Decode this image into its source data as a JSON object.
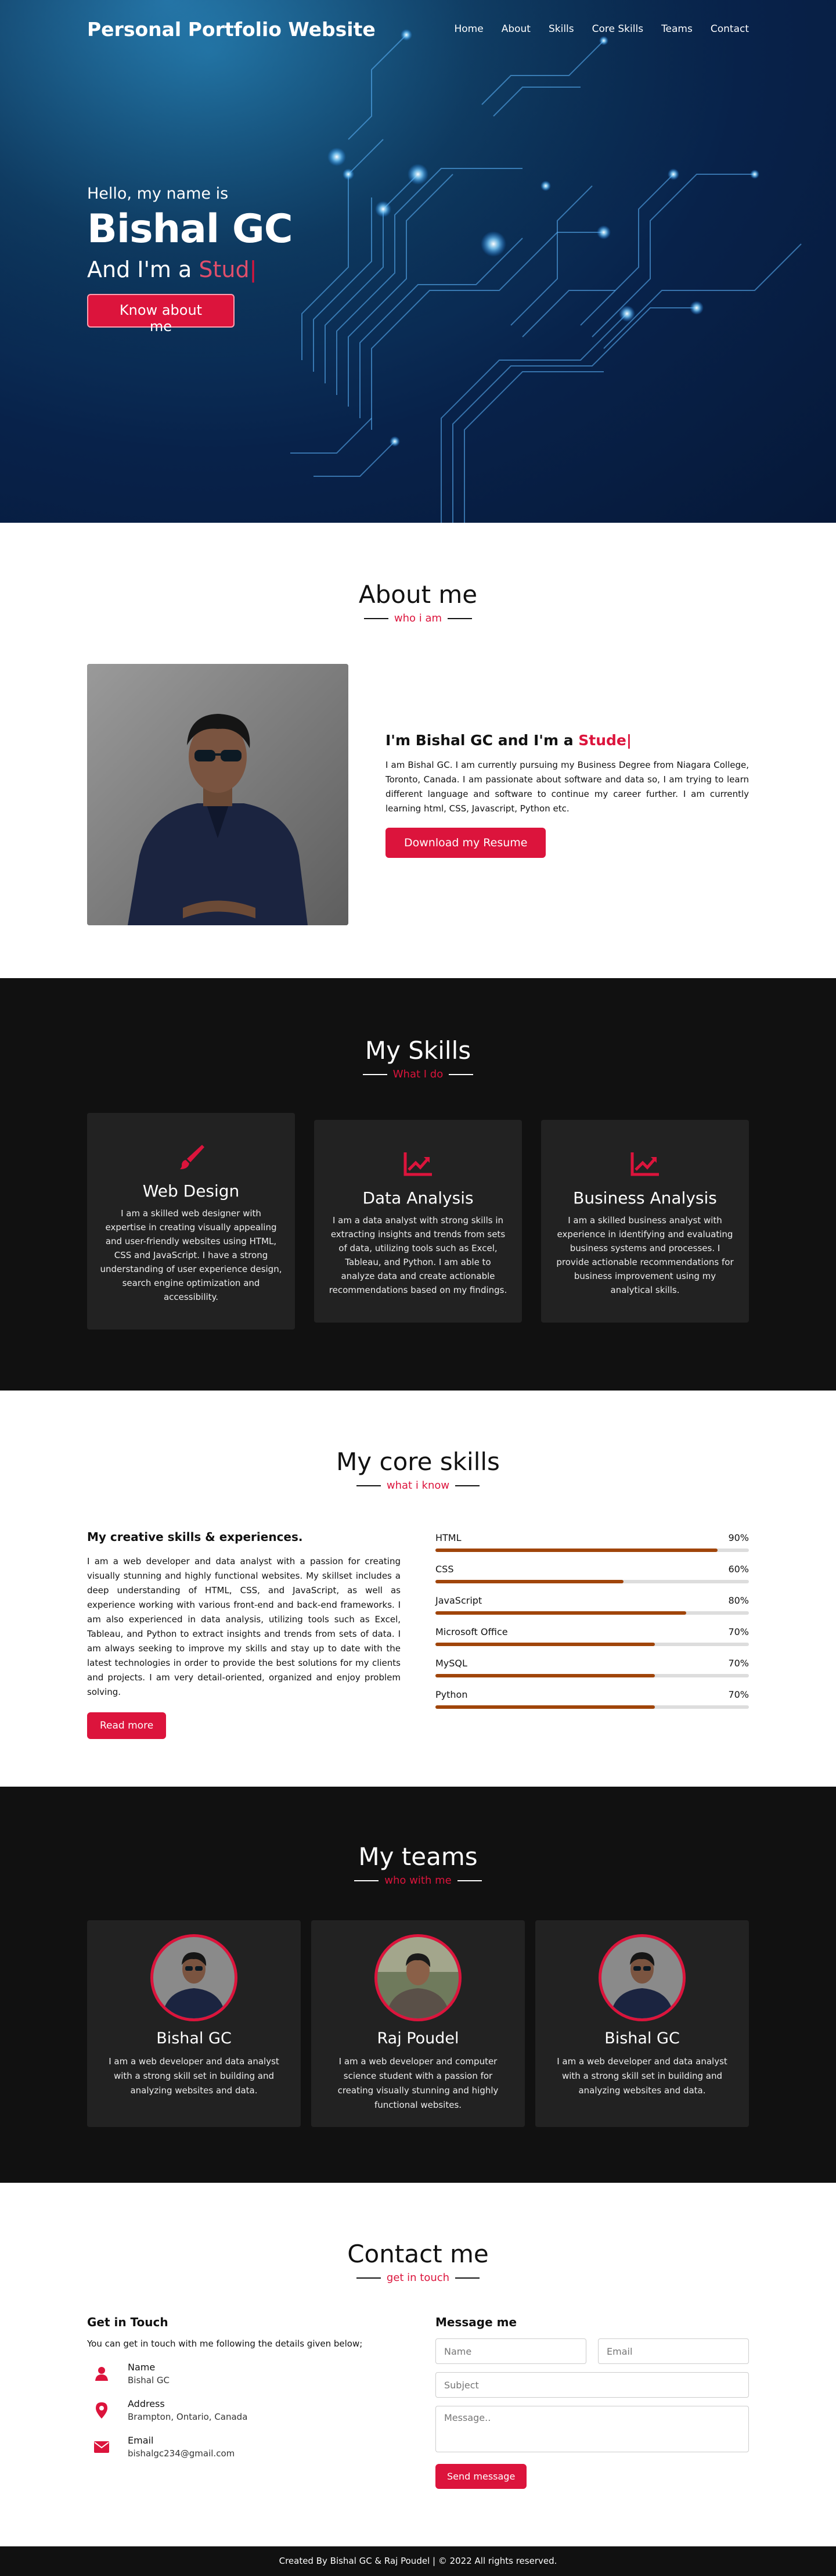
{
  "navbar": {
    "logo": "Personal Portfolio Website",
    "menu": [
      "Home",
      "About",
      "Skills",
      "Core Skills",
      "Teams",
      "Contact"
    ]
  },
  "hero": {
    "hello": "Hello, my name is",
    "name": "Bishal GC",
    "role_prefix": "And I'm a ",
    "role_typed": "Stud",
    "caret": "|",
    "button": "Know about me"
  },
  "about": {
    "title": "About me",
    "subtitle": "who i am",
    "heading_prefix": "I'm Bishal GC and I'm a ",
    "heading_typed": "Stude",
    "caret": "|",
    "paragraph": "I am Bishal GC. I am currently pursuing my Business Degree from Niagara College, Toronto, Canada. I am passionate about software and data so, I am trying to learn different language and software to continue my career further. I am currently learning html, CSS, Javascript, Python etc.",
    "button": "Download my Resume"
  },
  "services": {
    "title": "My Skills",
    "subtitle": "What I do",
    "cards": [
      {
        "icon": "paint-brush-icon",
        "title": "Web Design",
        "text": "I am a skilled web designer with expertise in creating visually appealing and user-friendly websites using HTML, CSS and JavaScript. I have a strong understanding of user experience design, search engine optimization and accessibility."
      },
      {
        "icon": "chart-line-icon",
        "title": "Data Analysis",
        "text": "I am a data analyst with strong skills in extracting insights and trends from sets of data, utilizing tools such as Excel, Tableau, and Python. I am able to analyze data and create actionable recommendations based on my findings."
      },
      {
        "icon": "chart-line-icon",
        "title": "Business Analysis",
        "text": "I am a skilled business analyst with experience in identifying and evaluating business systems and processes. I provide actionable recommendations for business improvement using my analytical skills."
      }
    ]
  },
  "skills": {
    "title": "My core skills",
    "subtitle": "what i know",
    "heading": "My creative skills & experiences.",
    "paragraph": "I am a web developer and data analyst with a passion for creating visually stunning and highly functional websites. My skillset includes a deep understanding of HTML, CSS, and JavaScript, as well as experience working with various front-end and back-end frameworks. I am also experienced in data analysis, utilizing tools such as Excel, Tableau, and Python to extract insights and trends from sets of data. I am always seeking to improve my skills and stay up to date with the latest technologies in order to provide the best solutions for my clients and projects. I am very detail-oriented, organized and enjoy problem solving.",
    "button": "Read more",
    "bars": [
      {
        "name": "HTML",
        "percent_label": "90%",
        "level": 0.9
      },
      {
        "name": "CSS",
        "percent_label": "60%",
        "level": 0.6
      },
      {
        "name": "JavaScript",
        "percent_label": "80%",
        "level": 0.8
      },
      {
        "name": "Microsoft Office",
        "percent_label": "70%",
        "level": 0.7
      },
      {
        "name": "MySQL",
        "percent_label": "70%",
        "level": 0.7
      },
      {
        "name": "Python",
        "percent_label": "70%",
        "level": 0.7
      }
    ]
  },
  "teams": {
    "title": "My teams",
    "subtitle": "who with me",
    "members": [
      {
        "name": "Bishal GC",
        "text": "I am a web developer and data analyst with a strong skill set in building and analyzing websites and data."
      },
      {
        "name": "Raj Poudel",
        "text": "I am a web developer and computer science student with a passion for creating visually stunning and highly functional websites."
      },
      {
        "name": "Bishal GC",
        "text": "I am a web developer and data analyst with a strong skill set in building and analyzing websites and data."
      }
    ]
  },
  "contact": {
    "title": "Contact me",
    "subtitle": "get in touch",
    "left_heading": "Get in Touch",
    "intro": "You can get in touch with me following the details given below;",
    "info": [
      {
        "icon": "user-icon",
        "label": "Name",
        "value": "Bishal GC"
      },
      {
        "icon": "map-marker-icon",
        "label": "Address",
        "value": "Brampton, Ontario, Canada"
      },
      {
        "icon": "envelope-icon",
        "label": "Email",
        "value": "bishalgc234@gmail.com"
      }
    ],
    "right_heading": "Message me",
    "placeholders": {
      "name": "Name",
      "email": "Email",
      "subject": "Subject",
      "message": "Message.."
    },
    "button": "Send message"
  },
  "footer": {
    "text": "Created By Bishal GC & Raj Poudel | © 2022 All rights reserved."
  },
  "colors": {
    "accent": "#dc143c",
    "dark": "#111111",
    "card": "#222222",
    "bar": "#a0450a"
  }
}
